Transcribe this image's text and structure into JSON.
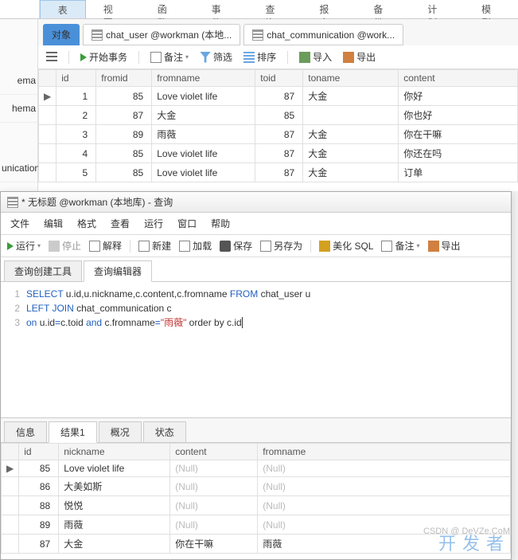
{
  "topmenu": [
    "表",
    "视图",
    "函数",
    "事件",
    "查询",
    "报表",
    "备份",
    "计划",
    "模型"
  ],
  "sidebar": [
    "ema",
    "hema",
    "unication"
  ],
  "tabs": [
    {
      "label": "对象",
      "active": true
    },
    {
      "label": "chat_user @workman (本地..."
    },
    {
      "label": "chat_communication @work..."
    }
  ],
  "toolbar": {
    "start": "开始事务",
    "note": "备注",
    "filter": "筛选",
    "sort": "排序",
    "import": "导入",
    "export": "导出"
  },
  "grid": {
    "cols": [
      "id",
      "fromid",
      "fromname",
      "toid",
      "toname",
      "content"
    ],
    "rows": [
      {
        "ptr": "▶",
        "id": "1",
        "fromid": "85",
        "fromname": "Love violet life",
        "toid": "87",
        "toname": "大金",
        "content": "你好"
      },
      {
        "ptr": "",
        "id": "2",
        "fromid": "87",
        "fromname": "大金",
        "toid": "85",
        "toname": "",
        "content": "你也好"
      },
      {
        "ptr": "",
        "id": "3",
        "fromid": "89",
        "fromname": "雨薇",
        "toid": "87",
        "toname": "大金",
        "content": "你在干嘛"
      },
      {
        "ptr": "",
        "id": "4",
        "fromid": "85",
        "fromname": "Love violet life",
        "toid": "87",
        "toname": "大金",
        "content": "你还在吗"
      },
      {
        "ptr": "",
        "id": "5",
        "fromid": "85",
        "fromname": "Love violet life",
        "toid": "87",
        "toname": "大金",
        "content": "订单"
      }
    ]
  },
  "qwin": {
    "title": "* 无标题 @workman (本地库) - 查询",
    "menu": [
      "文件",
      "编辑",
      "格式",
      "查看",
      "运行",
      "窗口",
      "帮助"
    ],
    "tb": {
      "run": "运行",
      "stop": "停止",
      "explain": "解释",
      "new": "新建",
      "load": "加载",
      "save": "保存",
      "saveas": "另存为",
      "beautify": "美化 SQL",
      "note": "备注",
      "export": "导出"
    },
    "tabs": [
      "查询创建工具",
      "查询编辑器"
    ],
    "sql": {
      "l1a": "SELECT",
      "l1b": " u.id,u.nickname,c.content,c.fromname ",
      "l1c": "FROM",
      "l1d": " chat_user u",
      "l2a": "LEFT JOIN",
      "l2b": " chat_communication c",
      "l3a": "on",
      "l3b": " u.id",
      "l3c": "=",
      "l3d": "c.toid ",
      "l3e": "and",
      "l3f": " c.fromname",
      "l3g": "=",
      "l3h": "\"雨薇\"",
      "l3i": " order by c.id"
    },
    "rtabs": [
      "信息",
      "结果1",
      "概况",
      "状态"
    ]
  },
  "result": {
    "cols": [
      "id",
      "nickname",
      "content",
      "fromname"
    ],
    "rows": [
      {
        "ptr": "▶",
        "id": "85",
        "nickname": "Love violet life",
        "content": "(Null)",
        "fromname": "(Null)"
      },
      {
        "ptr": "",
        "id": "86",
        "nickname": "大美如斯",
        "content": "(Null)",
        "fromname": "(Null)"
      },
      {
        "ptr": "",
        "id": "88",
        "nickname": "悦悦",
        "content": "(Null)",
        "fromname": "(Null)"
      },
      {
        "ptr": "",
        "id": "89",
        "nickname": "雨薇",
        "content": "(Null)",
        "fromname": "(Null)"
      },
      {
        "ptr": "",
        "id": "87",
        "nickname": "大金",
        "content": "你在干嘛",
        "fromname": "雨薇"
      }
    ]
  },
  "wm": {
    "a": "开发者",
    "b": "CSDN @ DeVZe.CoM"
  }
}
